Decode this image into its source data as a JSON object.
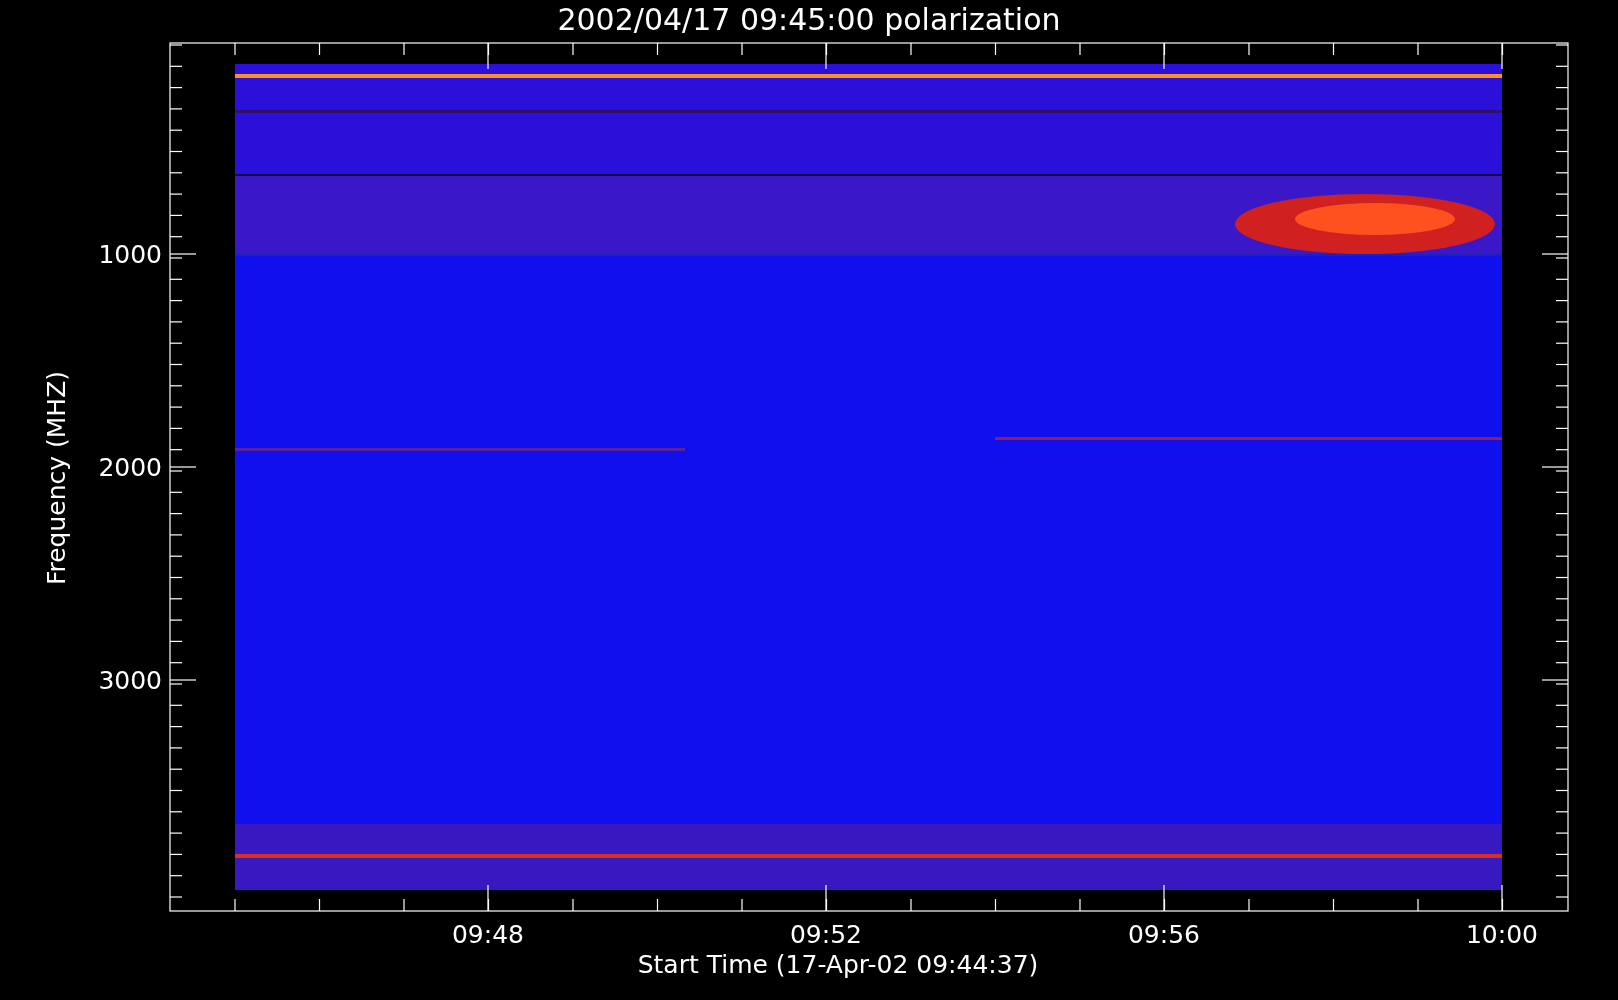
{
  "title": "2002/04/17 09:45:00 polarization",
  "y_axis": {
    "label": "Frequency (MHZ)",
    "ticks": [
      "1000",
      "2000",
      "3000"
    ]
  },
  "x_axis": {
    "label": "Start Time (17-Apr-02 09:44:37)",
    "ticks": [
      "09:48",
      "09:52",
      "09:56",
      "10:00"
    ]
  }
}
